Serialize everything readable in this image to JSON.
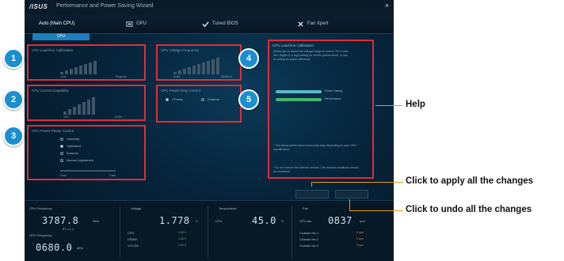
{
  "window": {
    "logo": "/ISUS",
    "title": "Performance and Power Saving Wizard",
    "close_glyph": "×"
  },
  "tabs": [
    {
      "label": "Auto (Main CPU)",
      "icon": "cpu-icon"
    },
    {
      "label": "GPU",
      "icon": "gpu-icon"
    },
    {
      "label": "Tuned BIOS",
      "icon": "check-icon"
    },
    {
      "label": "Fan Xpert",
      "icon": "fan-icon"
    }
  ],
  "subtab": "CPU",
  "panels": {
    "load_line": {
      "title": "CPU Load-line Calibration",
      "low": "Low",
      "high": "Regular"
    },
    "current": {
      "title": "CPU Current Capability",
      "low": "100",
      "high": "140%"
    },
    "power_phase": {
      "title": "CPU Power Phase Control",
      "options": [
        "Standard",
        "Optimized",
        "Extreme",
        "Manual Adjustment"
      ],
      "selected": 1,
      "slider_low": "Fast",
      "slider_high": "Fast"
    },
    "voltage_freq": {
      "title": "CPU Voltage Frequency",
      "low": "Auto",
      "high": "350KHz"
    },
    "duty": {
      "title": "CPU Power Duty Control",
      "options": [
        "T.Probe",
        "Extreme"
      ],
      "selected": 0
    }
  },
  "help": {
    "title": "CPU Load-line Calibration",
    "text": "Allows you to adjust the voltage range to control CPU Load-line. Higher is a high setting for certain performance, or low to setting for power efficiency.",
    "legend": [
      {
        "label": "Power Saving",
        "color": "#5fb6c9"
      },
      {
        "label": "Performance",
        "color": "#45b66b"
      }
    ],
    "note1": "* The actual performance boost may vary depending on your CPU specification.",
    "note2": "* Do not remove the thermal module. The thermal conditions should be monitored."
  },
  "buttons": {
    "apply": "",
    "undo": ""
  },
  "monitor": {
    "cpu": {
      "title": "CPU Frequency",
      "value": "3787.8",
      "unit": "MHz",
      "sub": "37 x 1.1",
      "sub2": "GPU Frequency",
      "value2": "0680.0",
      "unit2": "MHz"
    },
    "voltage": {
      "title": "Voltage",
      "value": "1.778",
      "unit": "V",
      "rows": [
        "CPU",
        "DRAM",
        "VCCSA"
      ],
      "vals": [
        "1.08 V",
        "1.04 V",
        "1.03 V"
      ]
    },
    "temp": {
      "title": "Temperature",
      "label": "CPU",
      "value": "45.0",
      "unit": "°C"
    },
    "fan": {
      "title": "Fan",
      "label": "CPU fan",
      "value": "0837",
      "unit": "rpm",
      "rows": [
        "Chassis fan 1",
        "Chassis fan 2",
        "Chassis fan 3"
      ],
      "vals": [
        "0 rpm",
        "0 rpm",
        "0 rpm"
      ]
    }
  },
  "annotations": {
    "help": "Help",
    "apply": "Click to apply all the changes",
    "undo": "Click to undo all the changes",
    "badges": [
      "1",
      "2",
      "3",
      "4",
      "5"
    ]
  },
  "colors": {
    "highlight": "#e02d36",
    "badge": "#1b8fd0",
    "leader": "#e89a16",
    "accent": "#1d7fbd"
  }
}
